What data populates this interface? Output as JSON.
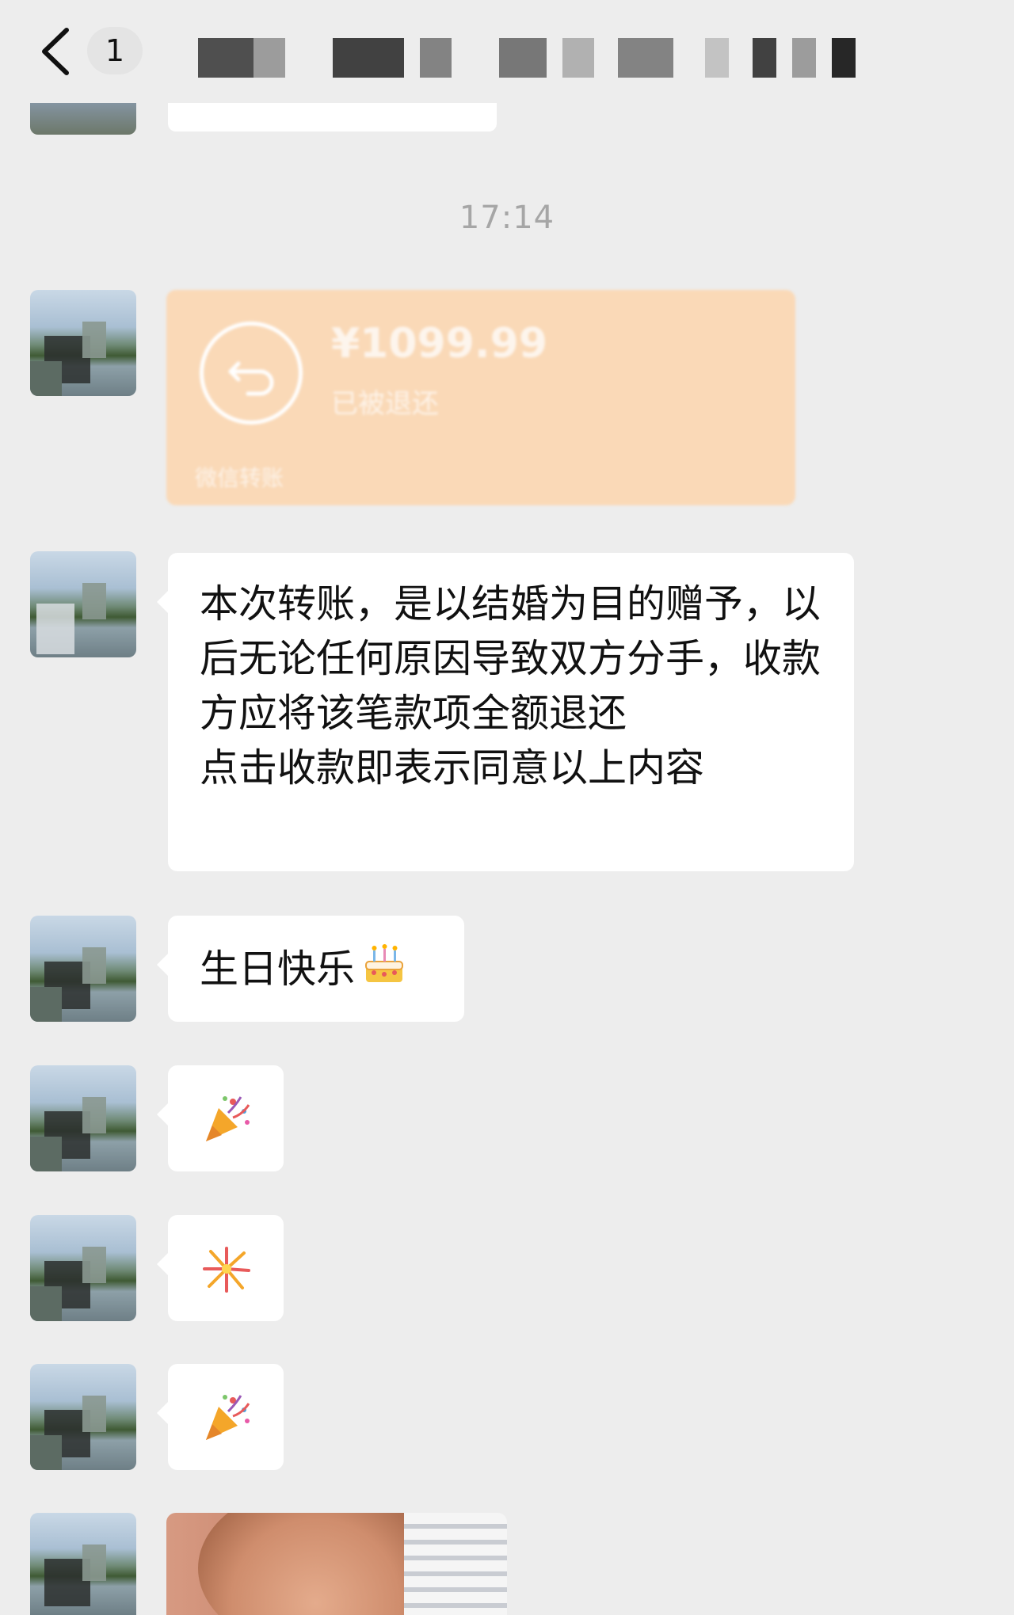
{
  "header": {
    "unread_count": "1"
  },
  "timestamp": "17:14",
  "transfer": {
    "amount": "¥1099.99",
    "status": "已被退还",
    "footer": "微信转账",
    "color": "#fad9b7"
  },
  "messages": {
    "agreement": "本次转账，是以结婚为目的赠予，以后无论任何原因导致双方分手，收款方应将该笔款项全额退还\n点击收款即表示同意以上内容",
    "birthday": "生日快乐",
    "birthday_icon": "cake-icon",
    "emoji_1": "party-popper-icon",
    "emoji_2": "fireworks-icon",
    "emoji_3": "party-popper-icon"
  },
  "colors": {
    "background": "#ededed",
    "bubble": "#ffffff",
    "timestamp": "#a6a6a6"
  }
}
